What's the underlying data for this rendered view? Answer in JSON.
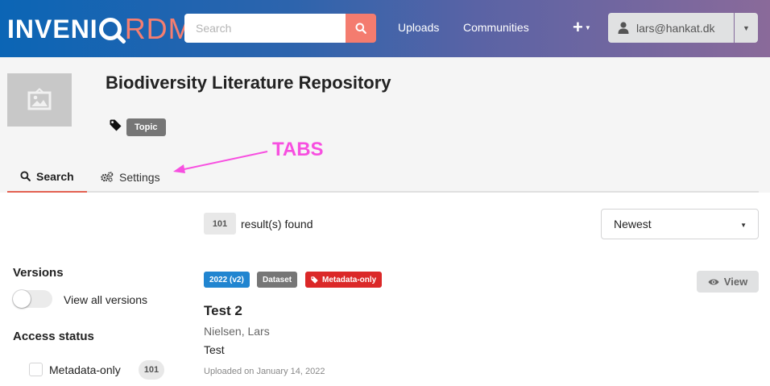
{
  "header": {
    "logo_text": "INVENIO",
    "logo_accent": "RDM",
    "search_placeholder": "Search",
    "nav": {
      "uploads": "Uploads",
      "communities": "Communities"
    },
    "plus_label": "+",
    "user_email": "lars@hankat.dk"
  },
  "community": {
    "title": "Biodiversity Literature Repository",
    "topic": "Topic"
  },
  "annotation": {
    "label": "TABS",
    "color": "#f74fe0"
  },
  "tabs": [
    {
      "label": "Search",
      "active": true
    },
    {
      "label": "Settings",
      "active": false
    }
  ],
  "results": {
    "count": "101",
    "found_text": "result(s) found",
    "sort_selected": "Newest"
  },
  "facets": {
    "versions": {
      "title": "Versions",
      "toggle_label": "View all versions"
    },
    "access": {
      "title": "Access status",
      "option": "Metadata-only",
      "option_count": "101"
    }
  },
  "item": {
    "version": "2022 (v2)",
    "type": "Dataset",
    "access": "Metadata-only",
    "view_label": "View",
    "title": "Test 2",
    "author": "Nielsen, Lars",
    "description": "Test",
    "date": "Uploaded on January 14, 2022"
  },
  "colors": {
    "brand_accent": "#f47c6f",
    "tab_underline": "#e36151",
    "version_label": "#2185d0",
    "access_label": "#db2828"
  }
}
